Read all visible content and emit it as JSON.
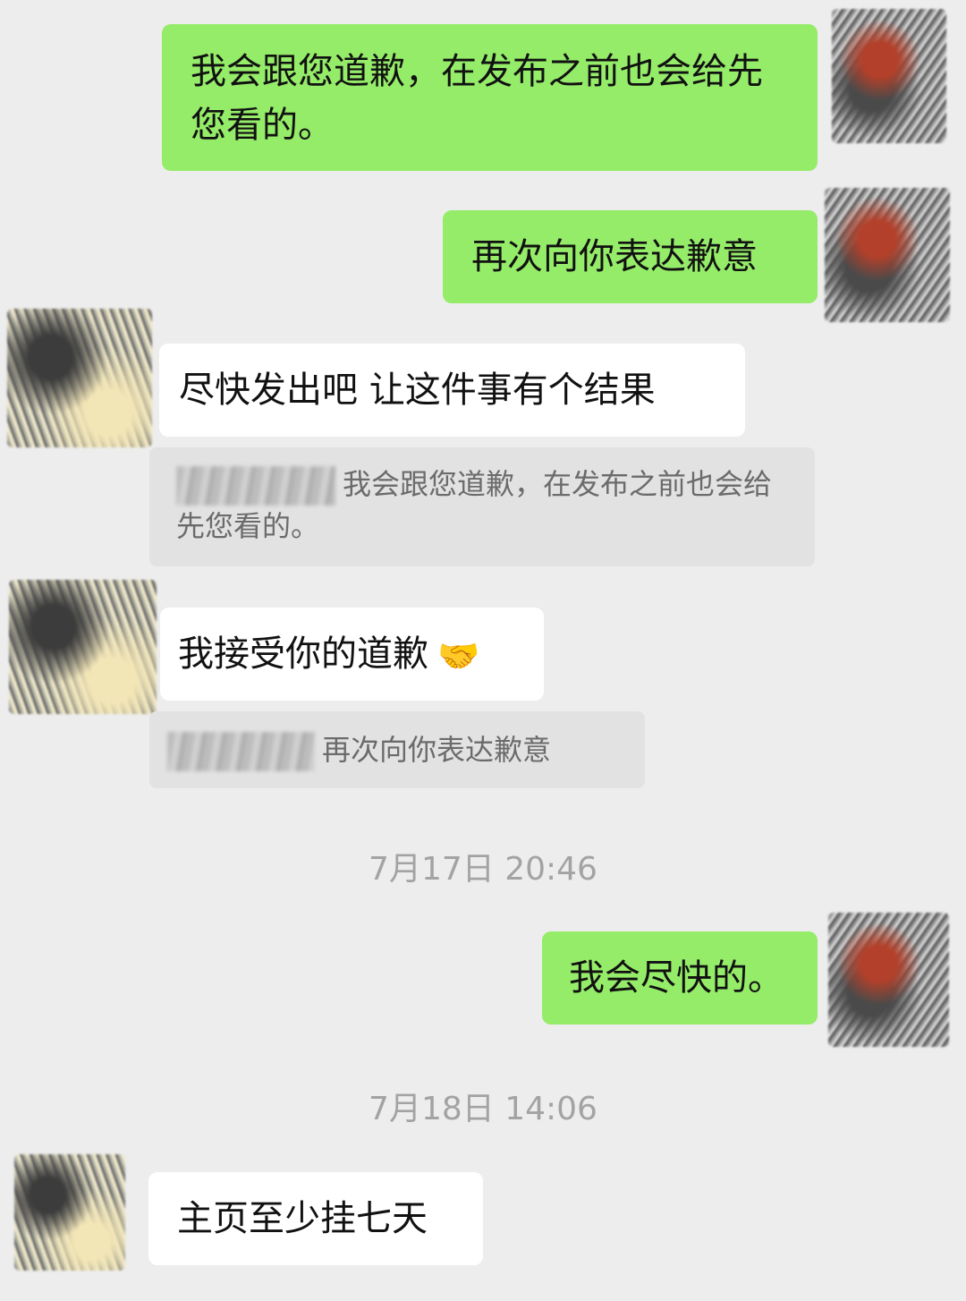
{
  "messages": [
    {
      "text": "我会跟您道歉，在发布之前也会给先您看的。"
    },
    {
      "text": "再次向你表达歉意"
    },
    {
      "text": "尽快发出吧 让这件事有个结果",
      "quote": "我会跟您道歉，在发布之前也会给先您看的。"
    },
    {
      "text": "我接受你的道歉",
      "emoji": "🤝",
      "quote": "再次向你表达歉意"
    },
    {
      "text": "我会尽快的。"
    },
    {
      "text": "主页至少挂七天"
    }
  ],
  "timestamps": [
    "7月17日 20:46",
    "7月18日 14:06"
  ]
}
